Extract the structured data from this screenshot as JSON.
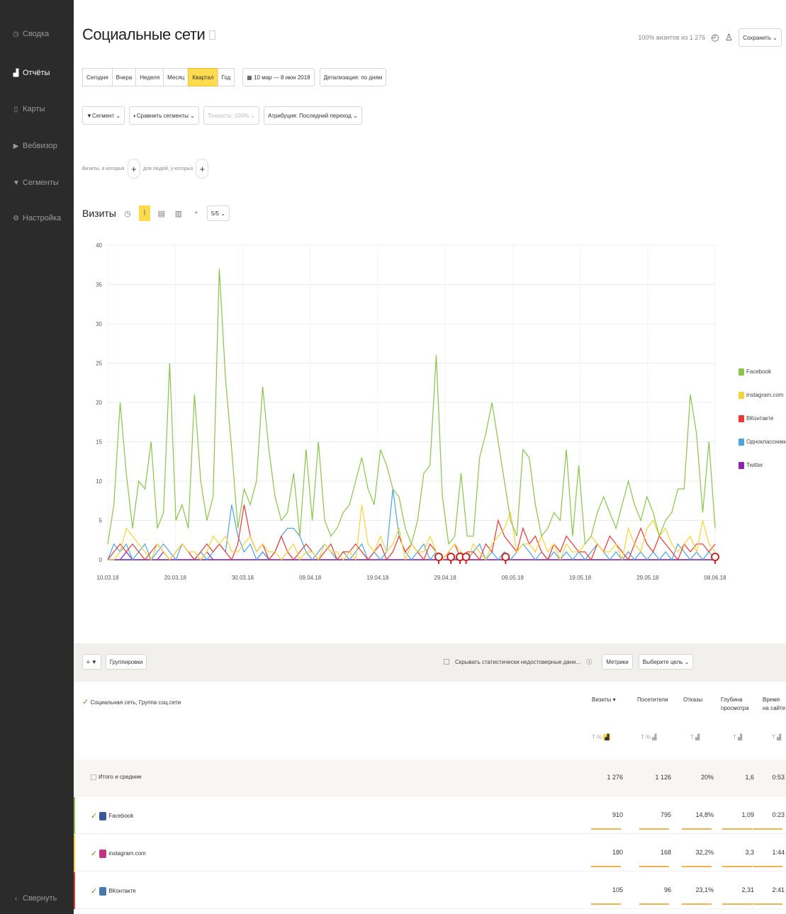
{
  "sidebar": {
    "items": [
      {
        "label": "Сводка",
        "icon": "clock-icon",
        "active": false
      },
      {
        "label": "Отчёты",
        "icon": "bar-chart-icon",
        "active": true
      },
      {
        "label": "Карты",
        "icon": "map-icon",
        "active": false
      },
      {
        "label": "Вебвизор",
        "icon": "play-icon",
        "active": false
      },
      {
        "label": "Сегменты",
        "icon": "filter-icon",
        "active": false
      },
      {
        "label": "Настройка",
        "icon": "gear-icon",
        "active": false
      }
    ],
    "collapse": "Свернуть"
  },
  "header": {
    "title": "Социальные сети",
    "visits_info": "100% визитов из 1 276",
    "save": "Сохранить"
  },
  "periods": [
    "Сегодня",
    "Вчера",
    "Неделя",
    "Месяц",
    "Квартал",
    "Год"
  ],
  "selected_period": "Квартал",
  "date_range": "10 мар — 8 июн 2018",
  "detail": "Детализация: по дням",
  "toolbar2": {
    "segment": "Сегмент",
    "compare": "Сравнить сегменты",
    "accuracy": "Точность: 100%",
    "attribution": "Атрибуция: Последний переход"
  },
  "filters": {
    "visits_text": "Визиты, в которых",
    "people_text": "для людей, у которых"
  },
  "chart_head": {
    "label": "Визиты",
    "groupby": "5/5"
  },
  "chart_data": {
    "type": "line",
    "ylim": [
      0,
      40
    ],
    "yticks": [
      0,
      5,
      10,
      15,
      20,
      25,
      30,
      35,
      40
    ],
    "xtick_labels": [
      "10.03.18",
      "20.03.18",
      "30.03.18",
      "09.04.18",
      "19.04.18",
      "29.04.18",
      "09.05.18",
      "19.05.18",
      "29.05.18",
      "08.06.18"
    ],
    "series": [
      {
        "name": "Facebook",
        "color": "#8bc34a",
        "values": [
          2,
          7,
          20,
          11,
          4,
          10,
          9,
          15,
          4,
          6,
          25,
          5,
          7,
          4,
          21,
          10,
          5,
          8,
          37,
          23,
          14,
          4,
          9,
          7,
          10,
          22,
          14,
          8,
          5,
          6,
          11,
          3,
          14,
          5,
          15,
          5,
          3,
          4,
          6,
          7,
          10,
          13,
          9,
          7,
          14,
          12,
          9,
          8,
          4,
          2,
          5,
          11,
          12,
          26,
          8,
          2,
          3,
          11,
          3,
          3,
          13,
          16,
          20,
          15,
          10,
          5,
          3,
          14,
          13,
          7,
          3,
          4,
          6,
          5,
          14,
          3,
          12,
          2,
          3,
          6,
          8,
          6,
          4,
          7,
          10,
          7,
          5,
          8,
          6,
          3,
          5,
          6,
          9,
          9,
          21,
          16,
          6,
          15,
          4
        ]
      },
      {
        "name": "instagram.com",
        "color": "#f5d33b",
        "values": [
          0,
          0,
          1,
          4,
          3,
          2,
          1,
          0,
          2,
          1,
          0,
          1,
          2,
          1,
          1,
          0,
          1,
          3,
          2,
          3,
          1,
          1,
          2,
          3,
          1,
          2,
          1,
          1,
          0,
          1,
          2,
          0,
          1,
          1,
          0,
          2,
          1,
          1,
          0,
          1,
          0,
          7,
          2,
          1,
          3,
          1,
          2,
          4,
          0,
          2,
          1,
          1,
          3,
          1,
          0,
          1,
          2,
          1,
          0,
          2,
          1,
          0,
          2,
          3,
          4,
          6,
          1,
          2,
          2,
          1,
          3,
          1,
          2,
          0,
          2,
          1,
          1,
          2,
          3,
          2,
          1,
          1,
          2,
          0,
          4,
          2,
          1,
          4,
          5,
          3,
          4,
          2,
          1,
          2,
          3,
          1,
          5,
          2,
          1
        ]
      },
      {
        "name": "ВКонтакте",
        "color": "#e53935",
        "values": [
          0,
          1,
          2,
          1,
          2,
          1,
          0,
          1,
          2,
          1,
          0,
          1,
          2,
          1,
          0,
          1,
          2,
          1,
          2,
          1,
          0,
          2,
          7,
          3,
          1,
          2,
          0,
          1,
          3,
          1,
          0,
          1,
          2,
          1,
          0,
          1,
          2,
          0,
          1,
          1,
          2,
          1,
          0,
          1,
          2,
          0,
          1,
          3,
          1,
          2,
          1,
          0,
          2,
          1,
          0,
          1,
          2,
          0,
          1,
          1,
          0,
          2,
          1,
          5,
          3,
          2,
          1,
          4,
          2,
          3,
          1,
          0,
          2,
          1,
          3,
          2,
          1,
          1,
          0,
          2,
          1,
          3,
          2,
          1,
          0,
          2,
          4,
          2,
          1,
          3,
          2,
          1,
          0,
          2,
          1,
          2,
          2,
          1,
          2
        ]
      },
      {
        "name": "Одноклассники",
        "color": "#4fa3e0",
        "values": [
          0,
          2,
          1,
          2,
          0,
          1,
          2,
          0,
          1,
          2,
          1,
          0,
          2,
          1,
          0,
          1,
          0,
          1,
          2,
          1,
          7,
          3,
          1,
          2,
          0,
          1,
          0,
          1,
          3,
          4,
          4,
          3,
          1,
          0,
          1,
          2,
          1,
          0,
          1,
          0,
          1,
          2,
          0,
          1,
          0,
          1,
          9,
          3,
          1,
          0,
          1,
          2,
          0,
          1,
          0,
          1,
          0,
          1,
          0,
          1,
          2,
          0,
          1,
          0,
          1,
          0,
          1,
          2,
          1,
          0,
          1,
          0,
          1,
          0,
          1,
          0,
          1,
          0,
          1,
          2,
          1,
          0,
          1,
          0,
          1,
          0,
          1,
          0,
          1,
          0,
          1,
          0,
          2,
          1,
          0,
          1,
          0,
          1,
          0
        ]
      },
      {
        "name": "Twitter",
        "color": "#8e24aa",
        "values": [
          0,
          0,
          0,
          1,
          0,
          0,
          0,
          0,
          0,
          1,
          0,
          0,
          0,
          0,
          0,
          0,
          1,
          0,
          0,
          0,
          0,
          0,
          0,
          0,
          0,
          1,
          0,
          0,
          0,
          0,
          0,
          0,
          0,
          0,
          0,
          0,
          0,
          0,
          0,
          0,
          0,
          0,
          0,
          0,
          0,
          0,
          0,
          0,
          0,
          0,
          0,
          0,
          0,
          0,
          0,
          0,
          0,
          0,
          0,
          0,
          0,
          0,
          0,
          0,
          0,
          0,
          0,
          0,
          0,
          0,
          0,
          0,
          0,
          0,
          0,
          0,
          0,
          0,
          0,
          0,
          0,
          0,
          0,
          0,
          0,
          0,
          0,
          0,
          0,
          0,
          0,
          0,
          0,
          0,
          0,
          0,
          0,
          0,
          0
        ]
      }
    ]
  },
  "table": {
    "grouping": "Группировки",
    "hide_text": "Скрывать статистически недостоверные данн...",
    "metrics": "Метрики",
    "goal": "Выберите цель",
    "main_header": "Социальная сеть, Группа соц.сети",
    "cols": [
      "Визиты",
      "Посетители",
      "Отказы",
      "Глубина просмотра",
      "Время на сайте"
    ],
    "rows": [
      {
        "name": "Итого и средние",
        "vals": [
          "1 276",
          "1 126",
          "20%",
          "1,6",
          "0:53"
        ],
        "color": "",
        "total": true
      },
      {
        "name": "Facebook",
        "vals": [
          "910",
          "795",
          "14,8%",
          "1,09",
          "0:23"
        ],
        "color": "#8bc34a",
        "total": false,
        "icon": "#3b5998"
      },
      {
        "name": "instagram.com",
        "vals": [
          "180",
          "168",
          "32,2%",
          "3,3",
          "1:44"
        ],
        "color": "#f5d33b",
        "total": false,
        "icon": "#c13584"
      },
      {
        "name": "ВКонтакте",
        "vals": [
          "105",
          "96",
          "23,1%",
          "2,31",
          "2:41"
        ],
        "color": "#e53935",
        "total": false,
        "icon": "#4a76a8"
      }
    ]
  }
}
